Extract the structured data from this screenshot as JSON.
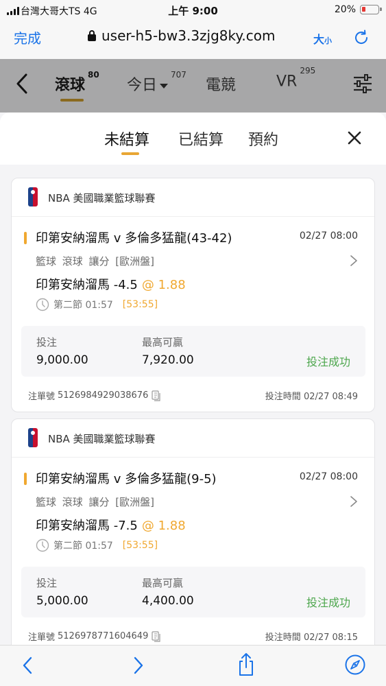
{
  "status_bar": {
    "carrier": "台灣大哥大TS  4G",
    "time": "上午 9:00",
    "battery": "20%",
    "battery_level": 0.2
  },
  "browser": {
    "done_label": "完成",
    "url": "user-h5-bw3.3zjg8ky.com",
    "text_size_big": "大",
    "text_size_small": "小"
  },
  "nav": {
    "tabs": [
      {
        "label": "滾球",
        "badge": "80",
        "active": true
      },
      {
        "label": "今日",
        "badge": "707",
        "has_dropdown": true
      },
      {
        "label": "電競",
        "badge": ""
      },
      {
        "label": "VR",
        "badge": "295"
      }
    ]
  },
  "sheet": {
    "tabs": [
      {
        "label": "未結算",
        "active": true
      },
      {
        "label": "已結算"
      },
      {
        "label": "預約"
      }
    ]
  },
  "bets": [
    {
      "league": "NBA 美國職業籃球聯賽",
      "match": "印第安納溜馬 v 多倫多猛龍(43-42)",
      "match_date": "02/27 08:00",
      "meta": "籃球  滾球  讓分 [歐洲盤]",
      "selection": "印第安納溜馬 -4.5",
      "odds": "@ 1.88",
      "period": "第二節  01:57",
      "score": "[53:55]",
      "stake_label": "投注",
      "stake": "9,000.00",
      "max_win_label": "最高可贏",
      "max_win": "7,920.00",
      "status": "投注成功",
      "order_label": "注單號",
      "order_no": "5126984929038676",
      "bet_time_label": "投注時間",
      "bet_time": "02/27 08:49"
    },
    {
      "league": "NBA 美國職業籃球聯賽",
      "match": "印第安納溜馬 v 多倫多猛龍(9-5)",
      "match_date": "02/27 08:00",
      "meta": "籃球  滾球  讓分 [歐洲盤]",
      "selection": "印第安納溜馬 -7.5",
      "odds": "@ 1.88",
      "period": "第二節  01:57",
      "score": "[53:55]",
      "stake_label": "投注",
      "stake": "5,000.00",
      "max_win_label": "最高可贏",
      "max_win": "4,400.00",
      "status": "投注成功",
      "order_label": "注單號",
      "order_no": "5126978771604649",
      "bet_time_label": "投注時間",
      "bet_time": "02/27 08:15"
    }
  ]
}
